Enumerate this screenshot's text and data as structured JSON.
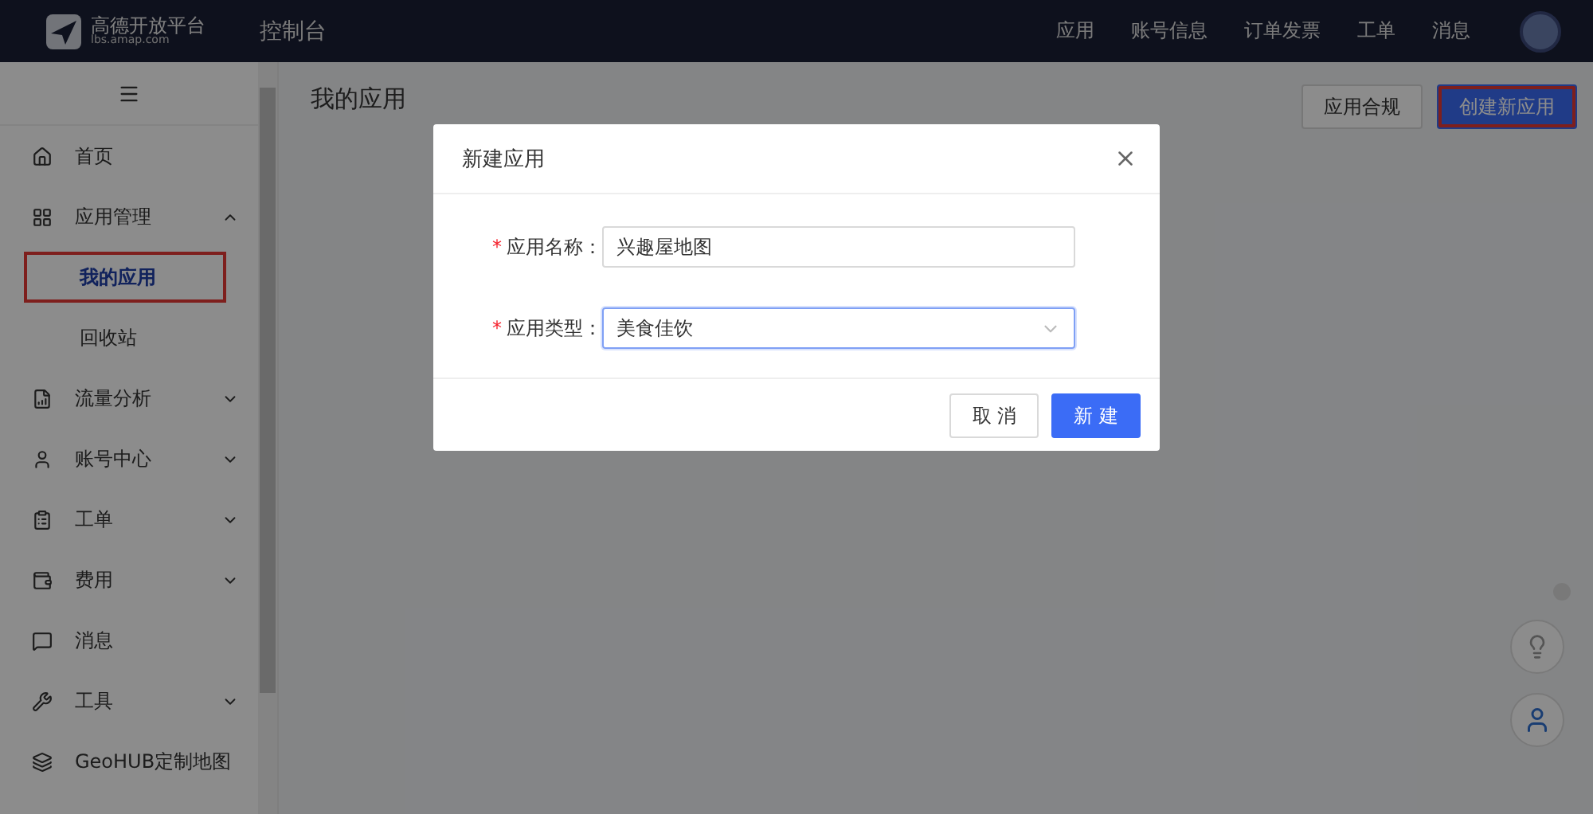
{
  "header": {
    "logo_title": "高德开放平台",
    "logo_subtitle": "lbs.amap.com",
    "console": "控制台",
    "nav": [
      "应用",
      "账号信息",
      "订单发票",
      "工单",
      "消息"
    ]
  },
  "sidebar": {
    "items": [
      {
        "label": "首页",
        "selected": false
      },
      {
        "label": "应用管理",
        "expanded": true,
        "selected": false,
        "children": [
          {
            "label": "我的应用",
            "selected": true,
            "highlighted": true
          },
          {
            "label": "回收站",
            "selected": false,
            "highlighted": false
          }
        ]
      },
      {
        "label": "流量分析",
        "expanded": false,
        "selected": false
      },
      {
        "label": "账号中心",
        "expanded": false,
        "selected": false
      },
      {
        "label": "工单",
        "expanded": false,
        "selected": false
      },
      {
        "label": "费用",
        "expanded": false,
        "selected": false
      },
      {
        "label": "消息",
        "selected": false
      },
      {
        "label": "工具",
        "expanded": false,
        "selected": false
      },
      {
        "label": "GeoHUB定制地图",
        "selected": false
      }
    ]
  },
  "page": {
    "title": "我的应用",
    "buttons": [
      {
        "label": "应用合规",
        "kind": "default",
        "highlighted": false
      },
      {
        "label": "创建新应用",
        "kind": "primary",
        "highlighted": true
      }
    ]
  },
  "dialog": {
    "title": "新建应用",
    "fields": [
      {
        "label": "应用名称：",
        "kind": "text",
        "required_mark": "*",
        "value": "兴趣屋地图",
        "focused": false
      },
      {
        "label": "应用类型：",
        "kind": "select",
        "required_mark": "*",
        "value": "美食佳饮",
        "focused": true
      }
    ],
    "buttons": [
      {
        "label": "取 消",
        "kind": "default"
      },
      {
        "label": "新 建",
        "kind": "primary"
      }
    ]
  }
}
